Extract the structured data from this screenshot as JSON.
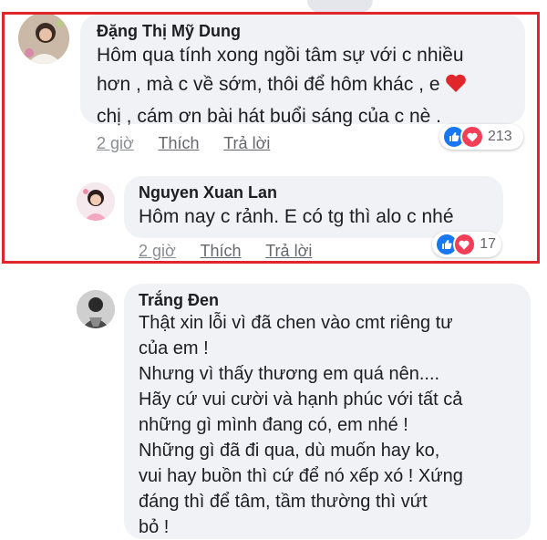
{
  "comments": [
    {
      "author": "Đặng Thị Mỹ Dung",
      "lines": [
        "Hôm qua tính xong ngồi tâm sự với c nhiều",
        "hơn , mà c về sớm, thôi để hôm khác , e",
        "chị , cám ơn bài hát buổi sáng của c nè ."
      ],
      "time": "2 giờ",
      "like_label": "Thích",
      "reply_label": "Trả lời",
      "reaction_count": "213"
    },
    {
      "author": "Nguyen Xuan Lan",
      "lines": [
        "Hôm nay c rảnh. E có tg thì alo c nhé"
      ],
      "time": "2 giờ",
      "like_label": "Thích",
      "reply_label": "Trả lời",
      "reaction_count": "17"
    },
    {
      "author": "Trắng Đen",
      "lines": [
        "Thật xin lỗi vì đã chen vào cmt riêng tư",
        "của em !",
        "Nhưng vì thấy thương em quá nên....",
        "Hãy cứ vui cười và hạnh phúc với tất cả",
        "những gì mình đang có, em nhé !",
        "Những gì đã đi qua, dù muốn hay ko,",
        "vui hay buồn thì cứ để nó xếp xó ! Xứng",
        "đáng thì để tâm, tầm thường thì vứt",
        "bỏ !"
      ]
    }
  ],
  "colors": {
    "highlight": "#e0262b",
    "like": "#1877f2",
    "love": "#f33e58",
    "bubble": "#f0f2f5"
  }
}
